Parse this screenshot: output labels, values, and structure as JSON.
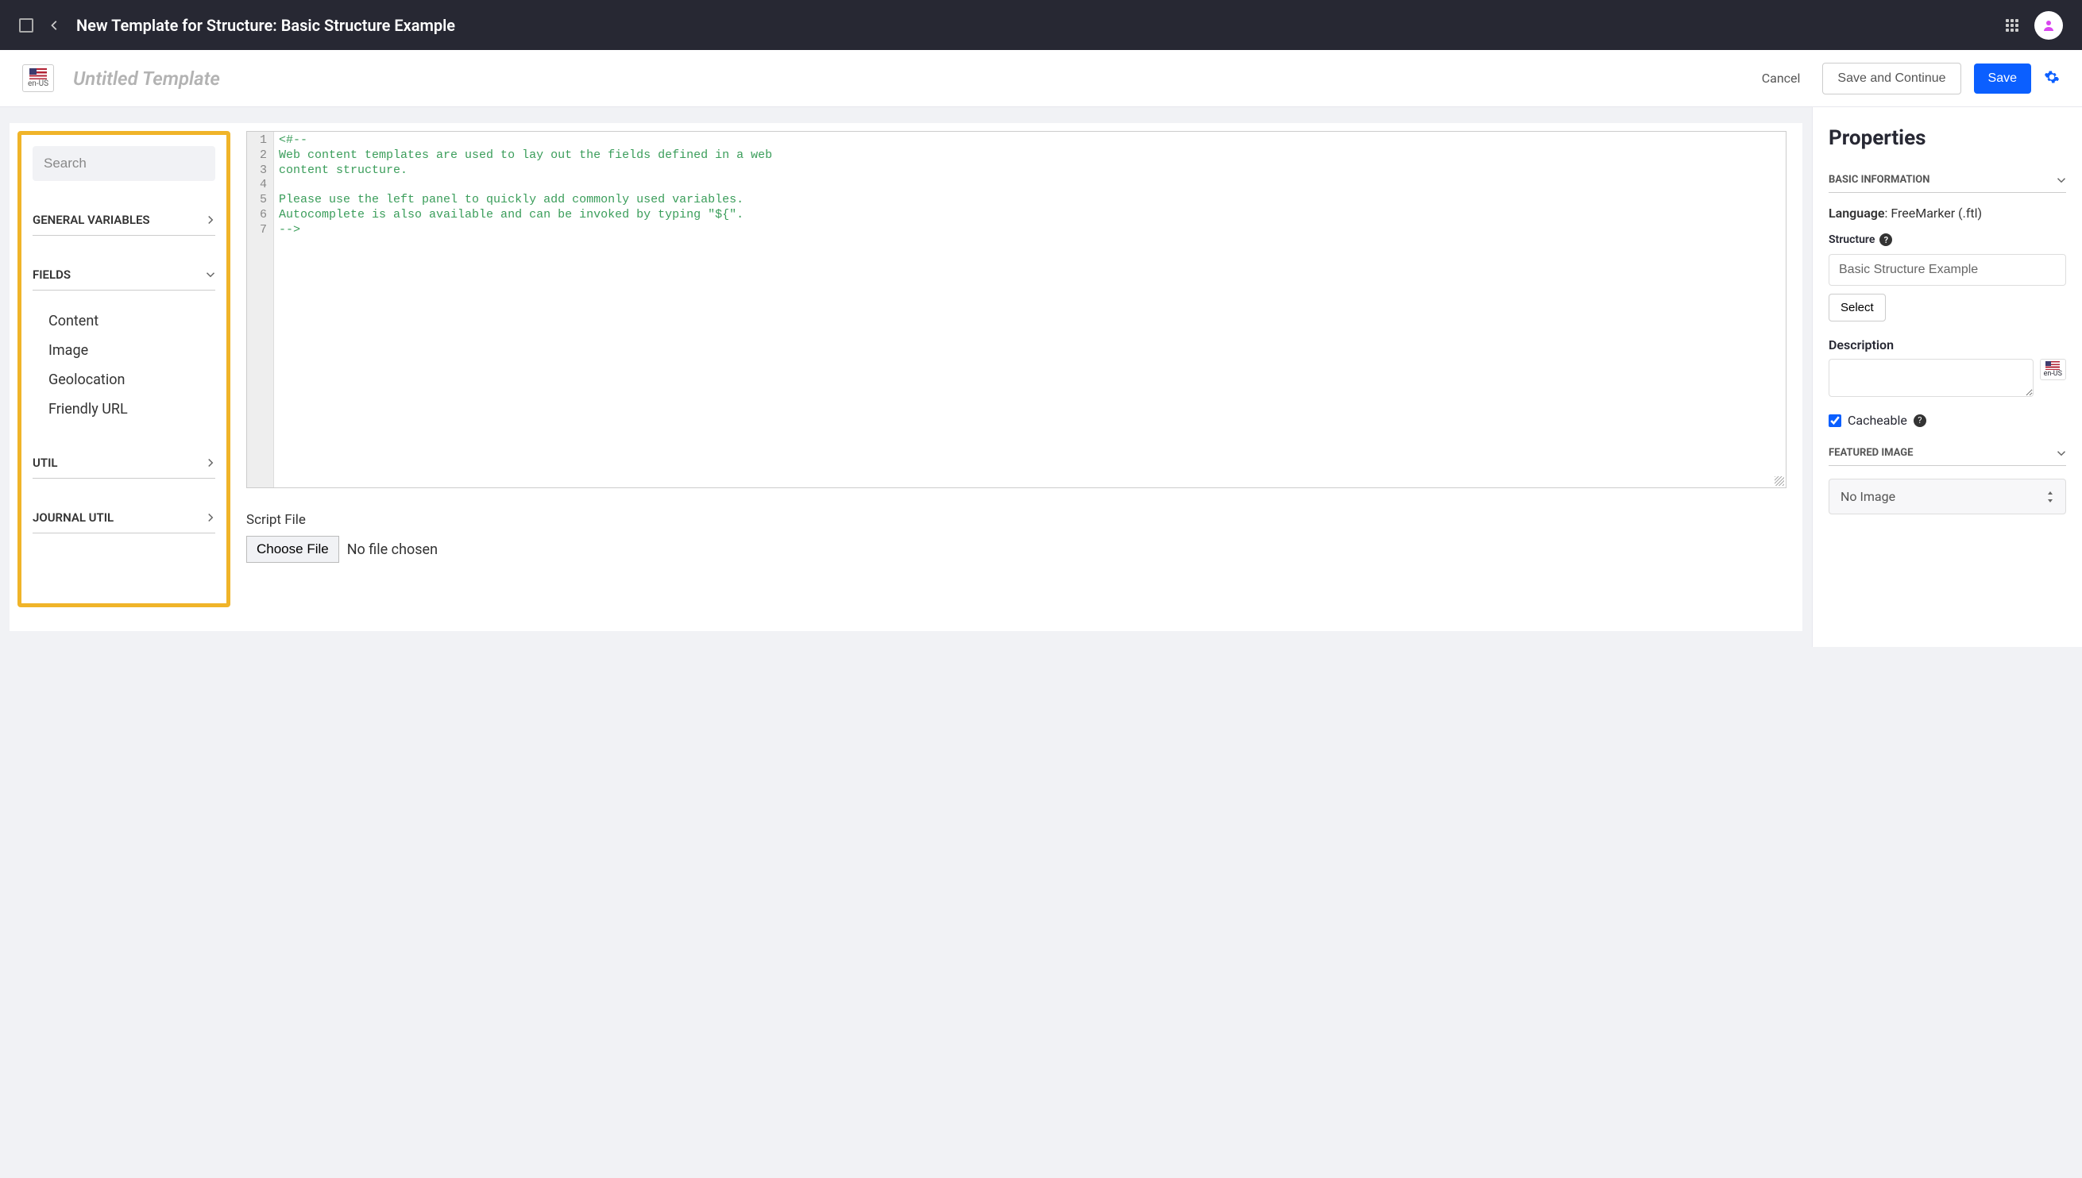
{
  "header": {
    "title": "New Template for Structure: Basic Structure Example",
    "locale": "en-US"
  },
  "subheader": {
    "template_name": "Untitled Template",
    "cancel": "Cancel",
    "save_continue": "Save and Continue",
    "save": "Save"
  },
  "sidebar": {
    "search_placeholder": "Search",
    "sections": {
      "general": "GENERAL VARIABLES",
      "fields": "FIELDS",
      "util": "UTIL",
      "journal_util": "JOURNAL UTIL"
    },
    "fields": [
      "Content",
      "Image",
      "Geolocation",
      "Friendly URL"
    ]
  },
  "editor": {
    "lines": [
      "<#--",
      "Web content templates are used to lay out the fields defined in a web",
      "content structure.",
      "",
      "Please use the left panel to quickly add commonly used variables.",
      "Autocomplete is also available and can be invoked by typing \"${\".",
      "-->"
    ],
    "script_file_label": "Script File",
    "choose_file": "Choose File",
    "no_file": "No file chosen"
  },
  "properties": {
    "title": "Properties",
    "basic_info": "BASIC INFORMATION",
    "language_label": "Language",
    "language_value": "FreeMarker (.ftl)",
    "structure_label": "Structure",
    "structure_value": "Basic Structure Example",
    "select_btn": "Select",
    "description_label": "Description",
    "cacheable_label": "Cacheable",
    "cacheable_checked": true,
    "featured_image": "FEATURED IMAGE",
    "featured_value": "No Image",
    "mini_locale": "en-US"
  }
}
